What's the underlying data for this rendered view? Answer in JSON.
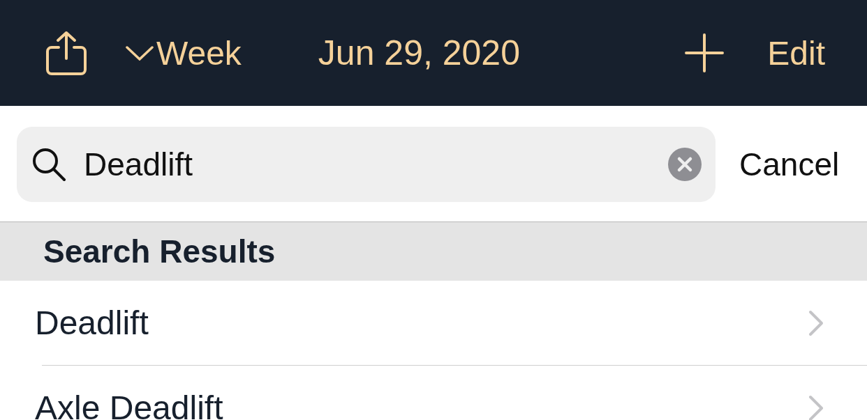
{
  "nav_bar": {
    "view_selector": "Week",
    "date": "Jun 29, 2020",
    "edit": "Edit"
  },
  "search": {
    "value": "Deadlift",
    "cancel": "Cancel"
  },
  "results": {
    "header": "Search Results",
    "rows": [
      {
        "label": "Deadlift"
      },
      {
        "label": "Axle Deadlift"
      }
    ]
  }
}
